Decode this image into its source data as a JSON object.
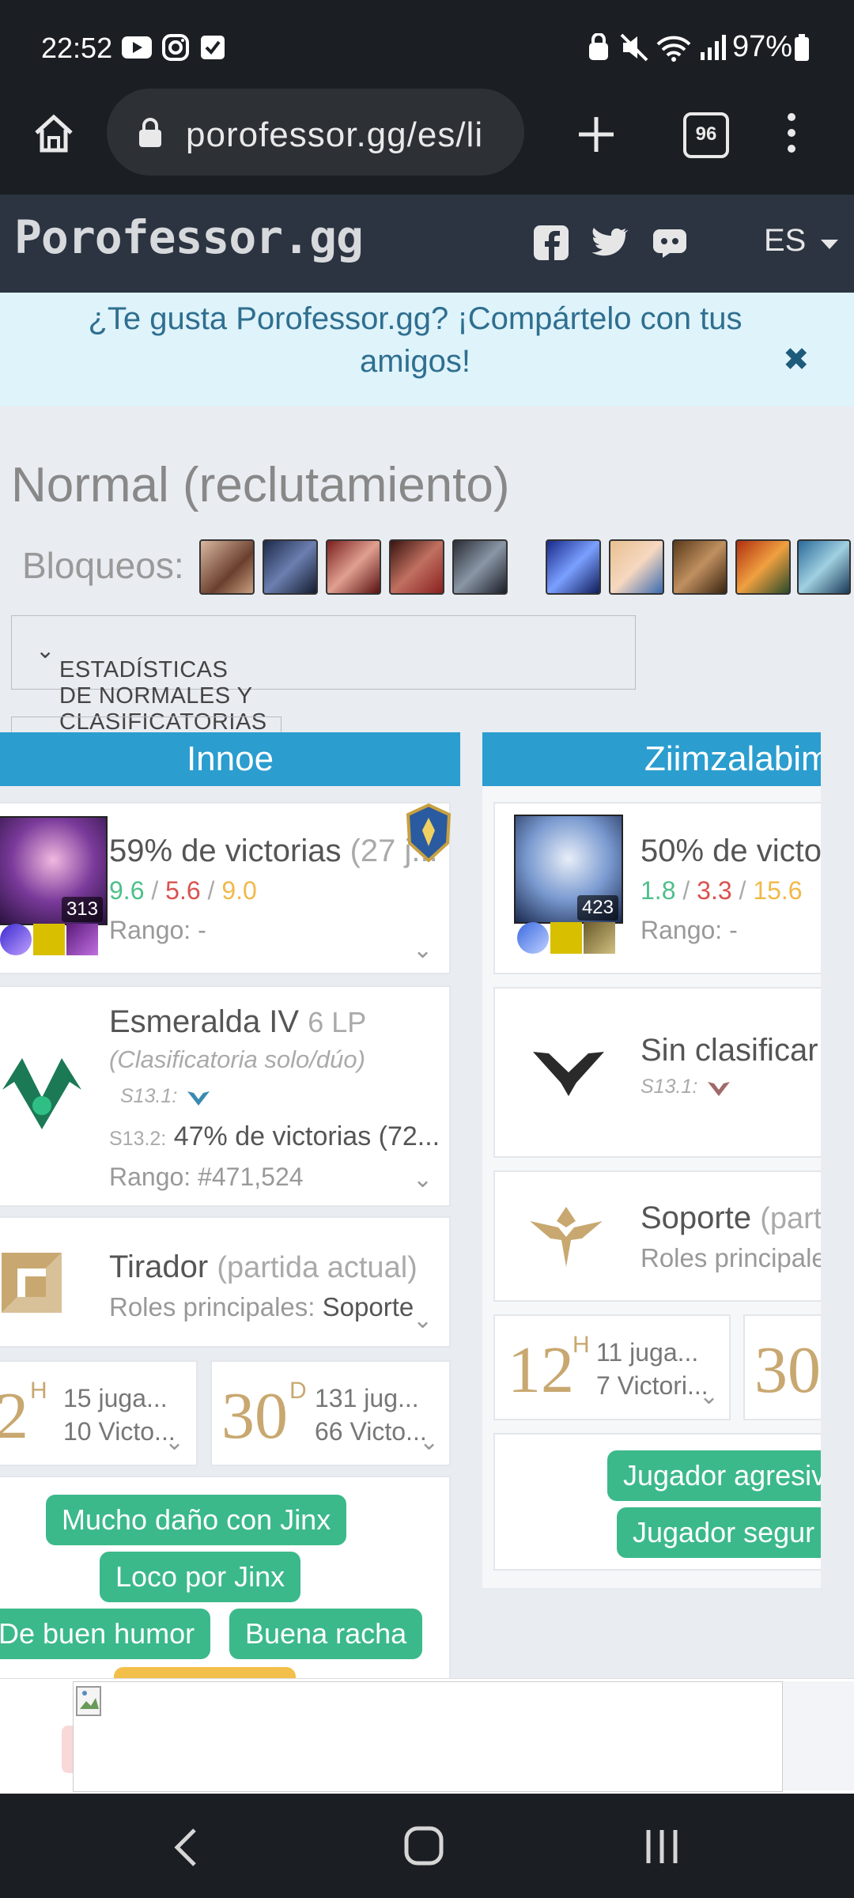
{
  "status": {
    "time": "22:52",
    "battery": "97%"
  },
  "browser": {
    "url": "porofessor.gg/es/li",
    "tabs_count": "96"
  },
  "site": {
    "logo": "Porofessor.gg",
    "language": "ES"
  },
  "banner": {
    "text": "¿Te gusta Porofessor.gg? ¡Compártelo con tus amigos!",
    "close": "✖"
  },
  "page": {
    "title": "Normal (reclutamiento)",
    "bans_label": "Bloqueos:",
    "stats_button": "ESTADÍSTICAS DE NORMALES Y CLASIFICATORIAS"
  },
  "players": [
    {
      "name": "Innoe",
      "champion_games": "313",
      "winrate": "59% de victorias",
      "games": "(27 j...",
      "kda": {
        "k": "9.6",
        "d": "5.6",
        "a": "9.0",
        "sep": "/"
      },
      "rank_label": "Rango: -",
      "league": "Esmeralda IV",
      "lp": "6 LP",
      "queue": "(Clasificatoria solo/dúo)",
      "prev_season": "S13.1:",
      "season": "S13.2:",
      "season_winrate": "47% de victorias (72...",
      "ranking": "Rango: #471,524",
      "role": "Tirador",
      "role_note": "(partida actual)",
      "main_roles_label": "Roles principales:",
      "main_roles_value": "Soporte",
      "hours": {
        "big": "2",
        "sup": "H",
        "l1": "15 juga...",
        "l2": "10 Victo..."
      },
      "days": {
        "big": "30",
        "sup": "D",
        "l1": "131 jug...",
        "l2": "66 Victo..."
      },
      "tags": [
        "Mucho daño con Jinx",
        "Loco por Jinx",
        "De buen humor",
        "Buena racha"
      ]
    },
    {
      "name": "Ziimzalabim",
      "champion_games": "423",
      "winrate": "50% de victo",
      "kda": {
        "k": "1.8",
        "d": "3.3",
        "a": "15.6",
        "sep": "/"
      },
      "rank_label": "Rango: -",
      "league": "Sin clasificar",
      "prev_season": "S13.1:",
      "role": "Soporte",
      "role_note": "(part",
      "main_roles_label": "Roles principale",
      "hours": {
        "big": "12",
        "sup": "H",
        "l1": "11 juga...",
        "l2": "7 Victori..."
      },
      "days": {
        "big": "30"
      },
      "tags": [
        "Jugador agresiv",
        "Jugador segur"
      ]
    }
  ],
  "colors": {
    "accent": "#2b9dcf",
    "tag": "#3bb98a",
    "kill": "#4fbf8a",
    "death": "#d9534f",
    "assist": "#f0b94a"
  }
}
